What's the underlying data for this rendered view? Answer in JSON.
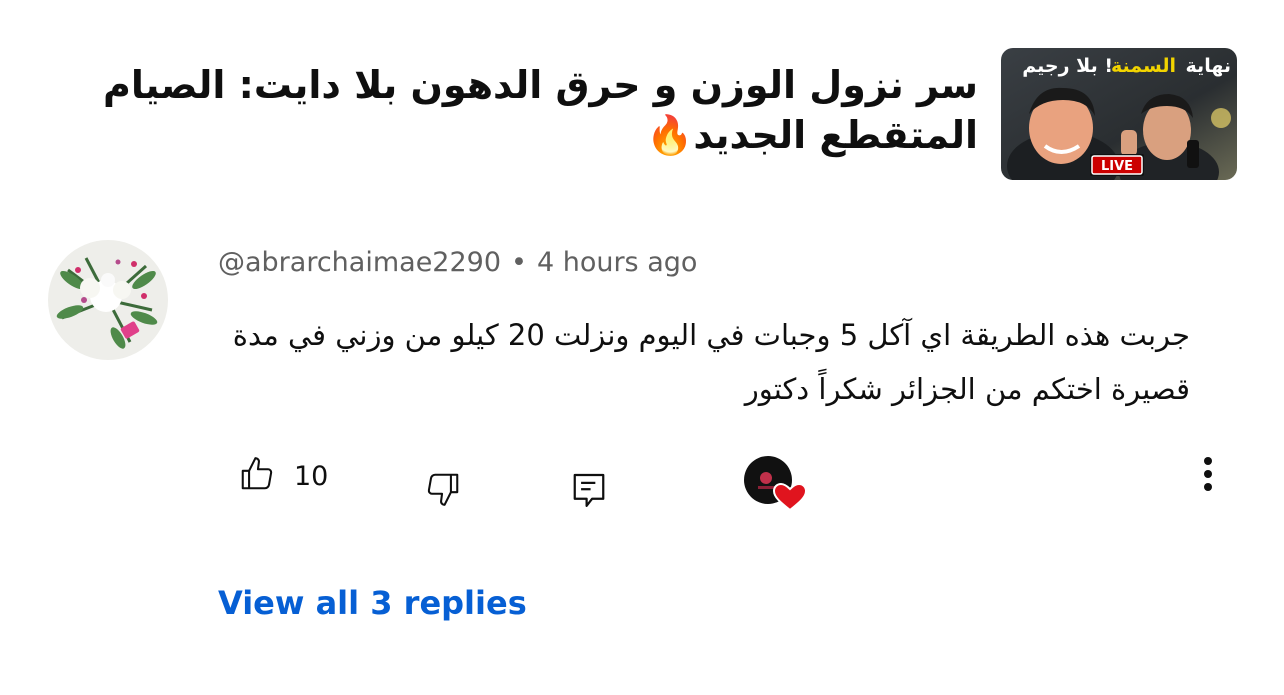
{
  "video": {
    "title": "سر نزول الوزن و حرق الدهون بلا دايت: الصيام المتقطع الجديد🔥",
    "thumbnail": {
      "overlay_text_white1": "نهاية",
      "overlay_text_yellow": "السمنة",
      "overlay_text_white2": "بلا رجيم !",
      "live_badge": "LIVE"
    }
  },
  "comment": {
    "author": "@abrarchaimae2290",
    "separator": "•",
    "time": "4 hours ago",
    "text": "جربت هذه الطريقة اي آكل 5 وجبات في اليوم ونزلت 20 كيلو من وزني في مدة قصيرة اختكم من الجزائر شكراً دكتور",
    "like_count": "10"
  },
  "replies": {
    "view_all_label": "View all 3 replies"
  },
  "icons": {
    "like": "thumbs-up-icon",
    "dislike": "thumbs-down-icon",
    "reply": "comment-icon",
    "hearted": "creator-heart-icon",
    "more": "more-vertical-icon"
  },
  "colors": {
    "link": "#065fd4",
    "meta": "#606060",
    "text": "#0f0f0f",
    "heart": "#e0141e"
  }
}
